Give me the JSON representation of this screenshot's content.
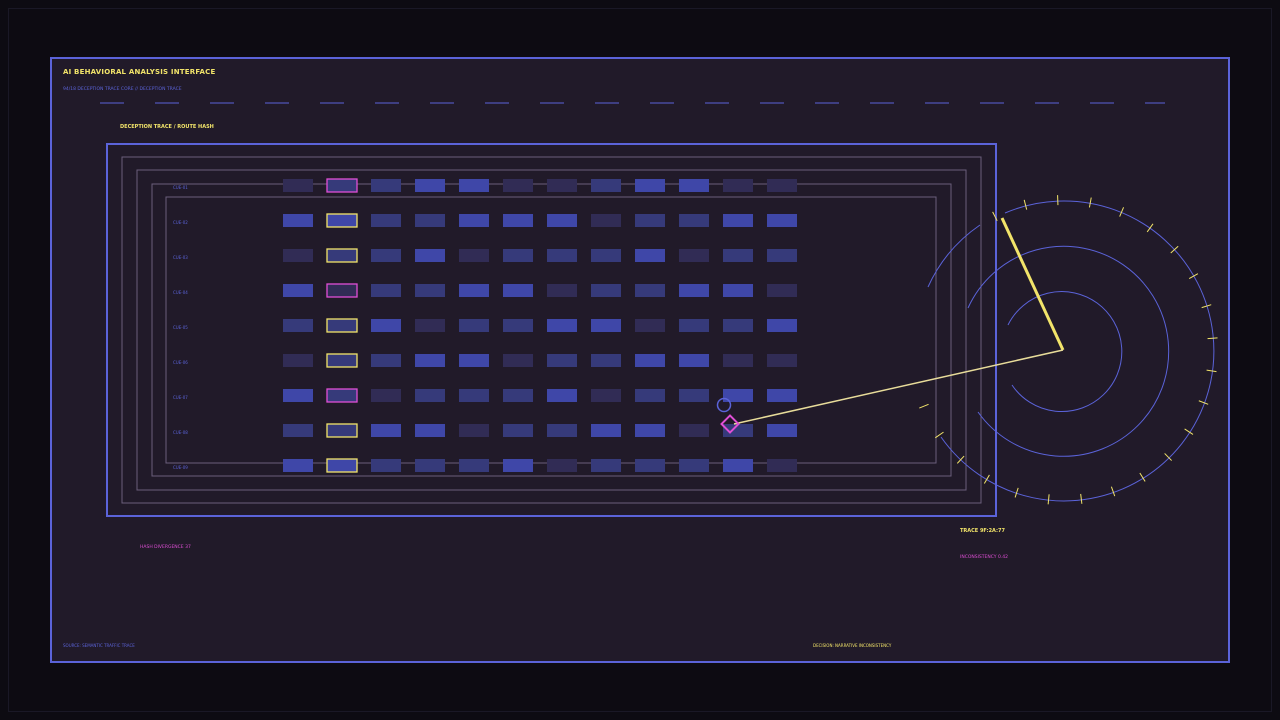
{
  "header": {
    "title": "AI BEHAVIORAL ANALYSIS INTERFACE",
    "subtitle": "94/18 DECEPTION TRACE CORE // DECEPTION TRACE"
  },
  "section_label": "DECEPTION TRACE / ROUTE HASH",
  "grid": {
    "rows": [
      {
        "label": "CUE-01",
        "cells": [
          1,
          2,
          2,
          3,
          3,
          1,
          1,
          2,
          3,
          3,
          1,
          1
        ],
        "outline": "magenta"
      },
      {
        "label": "CUE-02",
        "cells": [
          3,
          3,
          2,
          2,
          3,
          3,
          3,
          1,
          2,
          2,
          3,
          3
        ],
        "outline": "yellow"
      },
      {
        "label": "CUE-03",
        "cells": [
          1,
          2,
          2,
          3,
          1,
          2,
          2,
          2,
          3,
          1,
          2,
          2
        ],
        "outline": "yellow"
      },
      {
        "label": "CUE-04",
        "cells": [
          3,
          1,
          2,
          2,
          3,
          3,
          1,
          2,
          2,
          3,
          3,
          1
        ],
        "outline": "magenta"
      },
      {
        "label": "CUE-05",
        "cells": [
          2,
          2,
          3,
          1,
          2,
          2,
          3,
          3,
          1,
          2,
          2,
          3
        ],
        "outline": "yellow"
      },
      {
        "label": "CUE-06",
        "cells": [
          1,
          2,
          2,
          3,
          3,
          1,
          2,
          2,
          3,
          3,
          1,
          1
        ],
        "outline": "yellow"
      },
      {
        "label": "CUE-07",
        "cells": [
          3,
          2,
          1,
          2,
          2,
          2,
          3,
          1,
          2,
          2,
          3,
          3
        ],
        "outline": "magenta"
      },
      {
        "label": "CUE-08",
        "cells": [
          2,
          2,
          3,
          3,
          1,
          2,
          2,
          3,
          3,
          1,
          2,
          3
        ],
        "outline": "yellow"
      },
      {
        "label": "CUE-09",
        "cells": [
          3,
          3,
          2,
          2,
          2,
          3,
          1,
          2,
          2,
          2,
          3,
          1
        ],
        "outline": "yellow"
      }
    ],
    "highlight_col": 1,
    "marker": {
      "row": 7,
      "col": 10
    }
  },
  "status": {
    "trace": "TRACE 9F:2A:77",
    "inconsistency": "INCONSISTENCY 0.42",
    "hash_divergence": "HASH DIVERGENCE 37"
  },
  "footer": {
    "source": "SOURCE: SEMANTIC TRAFFIC TRACE",
    "decision": "DECISION: NARRATIVE INCONSISTENCY"
  },
  "colors": {
    "background": "#0d0b12",
    "panel": "#211a29",
    "accent_blue": "#5b63d9",
    "accent_yellow": "#f2e46a",
    "accent_magenta": "#e04fd6",
    "cell_dim": "#312c55",
    "cell_mid": "#363a7a",
    "cell_bright": "#3f47a8"
  },
  "icons": {
    "marker": "diamond-marker-icon",
    "target": "circle-target-icon",
    "radar": "radar-dial"
  }
}
